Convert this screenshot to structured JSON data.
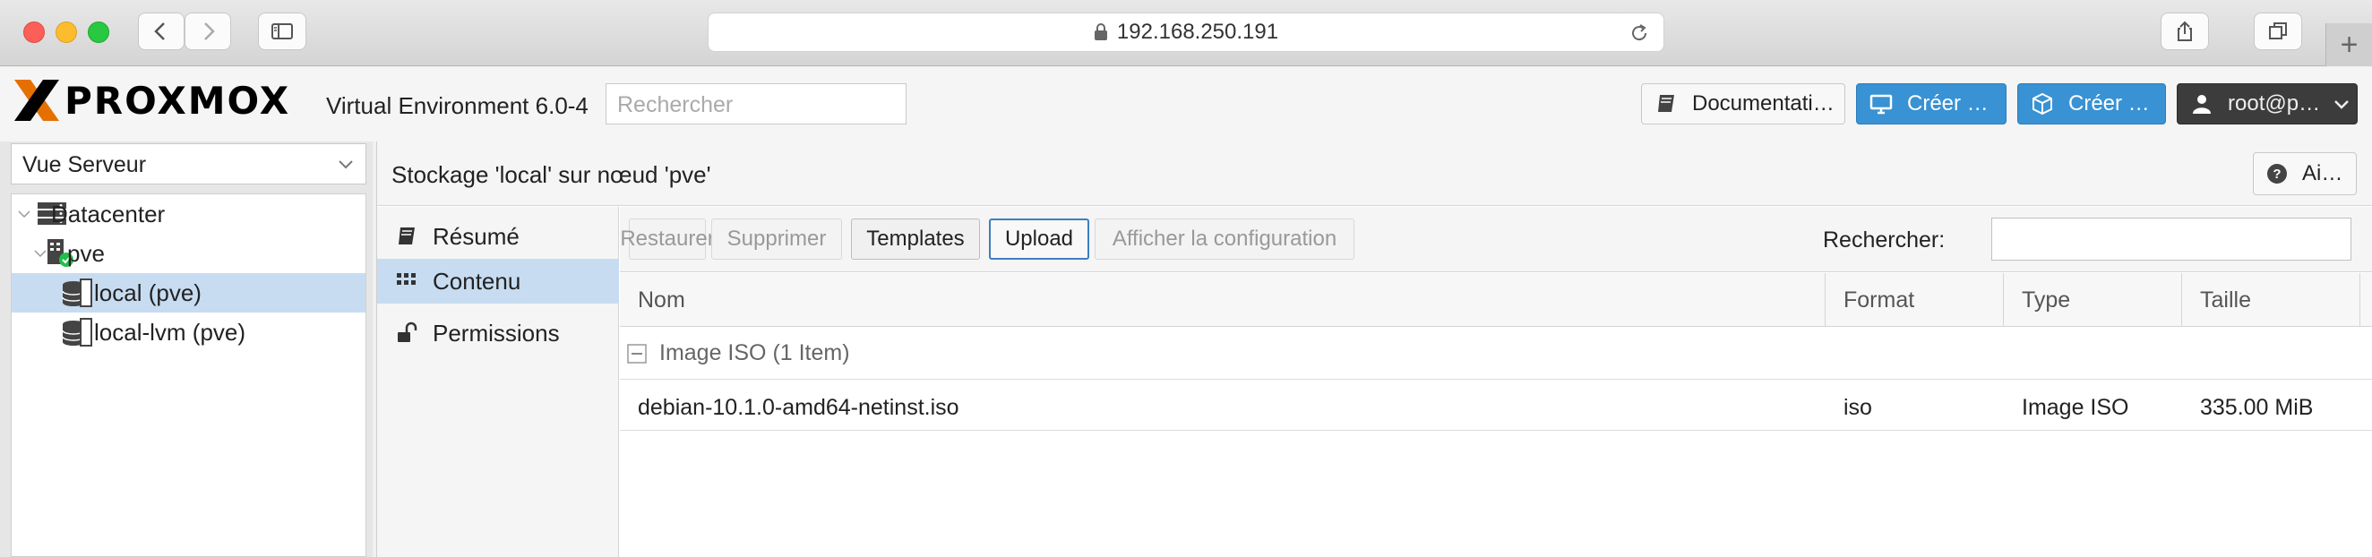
{
  "browser": {
    "url": "192.168.250.191",
    "new_tab_label": "+"
  },
  "header": {
    "logo_text": "PROXMOX",
    "version": "Virtual Environment 6.0-4",
    "search_placeholder": "Rechercher",
    "docs_label": "Documentati…",
    "create_vm_label": "Créer …",
    "create_ct_label": "Créer …",
    "user_label": "root@p…"
  },
  "sidebar": {
    "view_select": "Vue Serveur",
    "tree": [
      {
        "label": "Datacenter"
      },
      {
        "label": "pve"
      },
      {
        "label": "local (pve)"
      },
      {
        "label": "local-lvm (pve)"
      }
    ]
  },
  "content": {
    "title": "Stockage 'local' sur nœud 'pve'",
    "help_label": "Ai…",
    "subnav": [
      {
        "label": "Résumé"
      },
      {
        "label": "Contenu"
      },
      {
        "label": "Permissions"
      }
    ],
    "toolbar": {
      "restore": "Restaurer",
      "delete": "Supprimer",
      "templates": "Templates",
      "upload": "Upload",
      "show_config": "Afficher la configuration",
      "search_label": "Rechercher:"
    },
    "columns": [
      "Nom",
      "Format",
      "Type",
      "Taille"
    ],
    "group_label": "Image ISO (1 Item)",
    "rows": [
      {
        "name": "debian-10.1.0-amd64-netinst.iso",
        "format": "iso",
        "type": "Image ISO",
        "size": "335.00 MiB"
      }
    ]
  },
  "colors": {
    "accent_blue": "#3892d4",
    "selection": "#c7dcf1",
    "logo_orange": "#e57000"
  }
}
